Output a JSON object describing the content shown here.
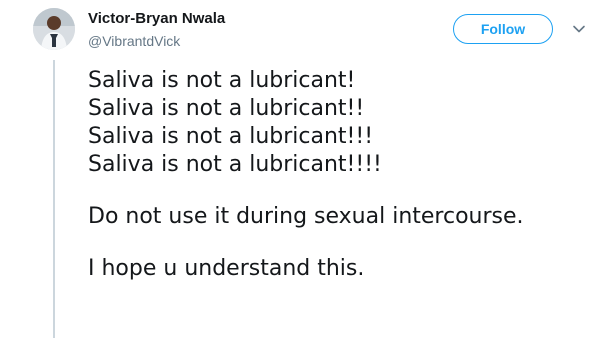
{
  "author": {
    "name": "Victor-Bryan Nwala",
    "handle": "@VibrantdVick",
    "avatar": "avatar-photo"
  },
  "actions": {
    "follow_label": "Follow",
    "more_icon": "chevron-down-icon"
  },
  "tweet": {
    "lines": [
      "Saliva is not a lubricant!",
      "Saliva is not a lubricant!!",
      "Saliva is not a lubricant!!!",
      "Saliva is not a lubricant!!!!",
      "Do not use it during sexual intercourse.",
      "I hope u understand this."
    ]
  },
  "colors": {
    "accent": "#1da1f2",
    "text": "#14171a",
    "secondary_text": "#657786",
    "thread_line": "#ccd6dd"
  }
}
